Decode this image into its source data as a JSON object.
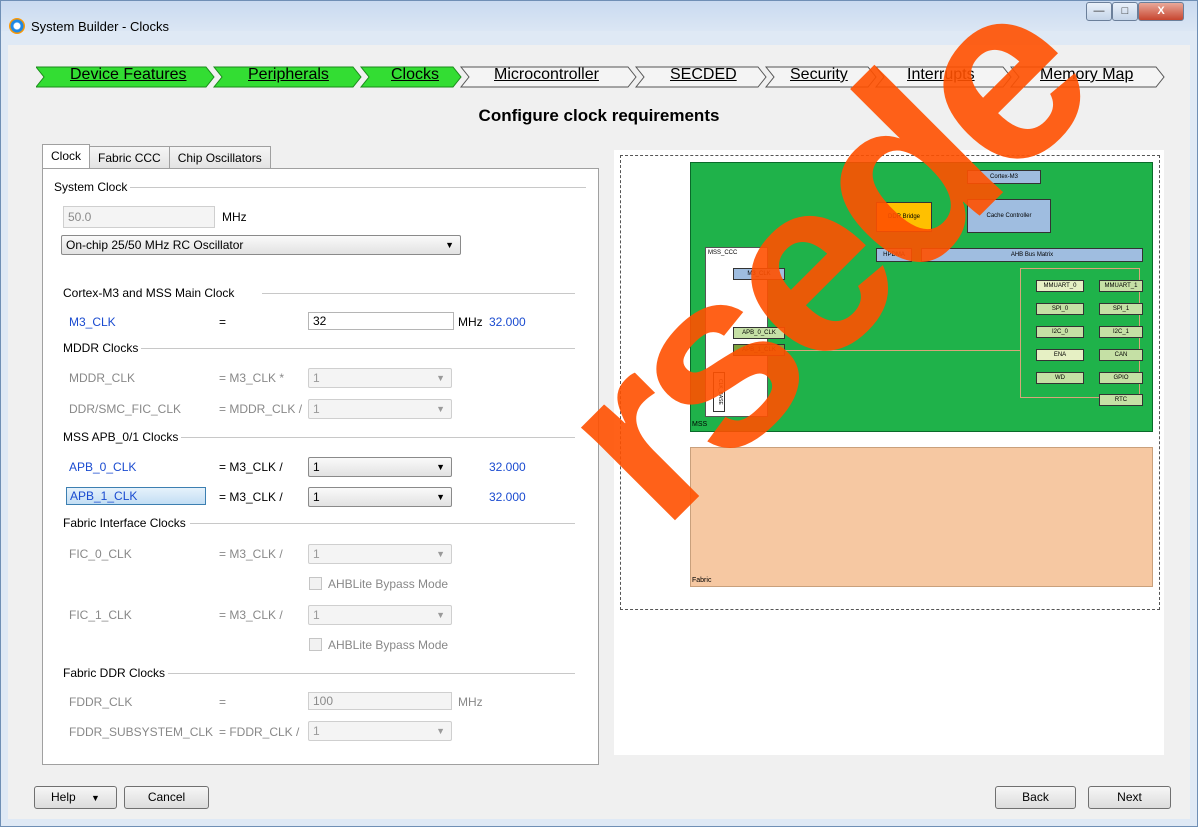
{
  "window": {
    "title": "System Builder - Clocks",
    "min": "—",
    "max": "□",
    "close": "X"
  },
  "steps": [
    {
      "label": "Device Features",
      "done": true
    },
    {
      "label": "Peripherals",
      "done": true
    },
    {
      "label": "Clocks",
      "done": true
    },
    {
      "label": "Microcontroller",
      "done": false
    },
    {
      "label": "SECDED",
      "done": false
    },
    {
      "label": "Security",
      "done": false
    },
    {
      "label": "Interrupts",
      "done": false
    },
    {
      "label": "Memory Map",
      "done": false
    }
  ],
  "heading": "Configure clock requirements",
  "tabs": [
    "Clock",
    "Fabric CCC",
    "Chip Oscillators"
  ],
  "system_clock": {
    "group": "System Clock",
    "value": "50.0",
    "unit": "MHz",
    "source": "On-chip 25/50 MHz RC Oscillator"
  },
  "cortex": {
    "group": "Cortex-M3 and MSS Main Clock",
    "label": "M3_CLK",
    "eq": "=",
    "value": "32",
    "unit": "MHz",
    "result": "32.000"
  },
  "mddr": {
    "group": "MDDR Clocks",
    "mddr_label": "MDDR_CLK",
    "mddr_eq": "= M3_CLK *",
    "mddr_val": "1",
    "ddr_label": "DDR/SMC_FIC_CLK",
    "ddr_eq": "= MDDR_CLK /",
    "ddr_val": "1"
  },
  "apb": {
    "group": "MSS APB_0/1 Clocks",
    "apb0_label": "APB_0_CLK",
    "apb0_eq": "= M3_CLK /",
    "apb0_val": "1",
    "apb0_res": "32.000",
    "apb1_label": "APB_1_CLK",
    "apb1_eq": "= M3_CLK /",
    "apb1_val": "1",
    "apb1_res": "32.000"
  },
  "fic": {
    "group": "Fabric Interface Clocks",
    "fic0_label": "FIC_0_CLK",
    "fic0_eq": "= M3_CLK /",
    "fic0_val": "1",
    "bypass": "AHBLite Bypass Mode",
    "fic1_label": "FIC_1_CLK",
    "fic1_eq": "= M3_CLK /",
    "fic1_val": "1"
  },
  "fddr": {
    "group": "Fabric DDR Clocks",
    "fddr_label": "FDDR_CLK",
    "fddr_eq": "=",
    "fddr_val": "100",
    "unit": "MHz",
    "sub_label": "FDDR_SUBSYSTEM_CLK",
    "sub_eq": "= FDDR_CLK /",
    "sub_val": "1"
  },
  "diagram": {
    "cortex": "Cortex-M3",
    "ddr_bridge": "DDR Bridge",
    "cache": "Cache Controller",
    "hpdma": "HPDMA",
    "ahb": "AHB Bus Matrix",
    "mss_ccc": "MSS_CCC",
    "m3_clk": "M3_CLK",
    "apb0": "APB_0_CLK",
    "apb1": "APB_1_CLK",
    "clk_base": "CLK_BASE",
    "left_col": [
      "MMUART_0",
      "SPI_0",
      "I2C_0",
      "ENA",
      "WD"
    ],
    "right_col": [
      "MMUART_1",
      "SPI_1",
      "I2C_1",
      "CAN",
      "GPIO",
      "RTC"
    ],
    "mss": "MSS",
    "fabric": "Fabric"
  },
  "buttons": {
    "help": "Help",
    "cancel": "Cancel",
    "back": "Back",
    "next": "Next"
  },
  "watermark": "rsede",
  "colors": {
    "step_done": "#33dd33",
    "mss_green": "#1fb24a",
    "fabric_peach": "#f6c8a2",
    "watermark": "#ff5000"
  }
}
